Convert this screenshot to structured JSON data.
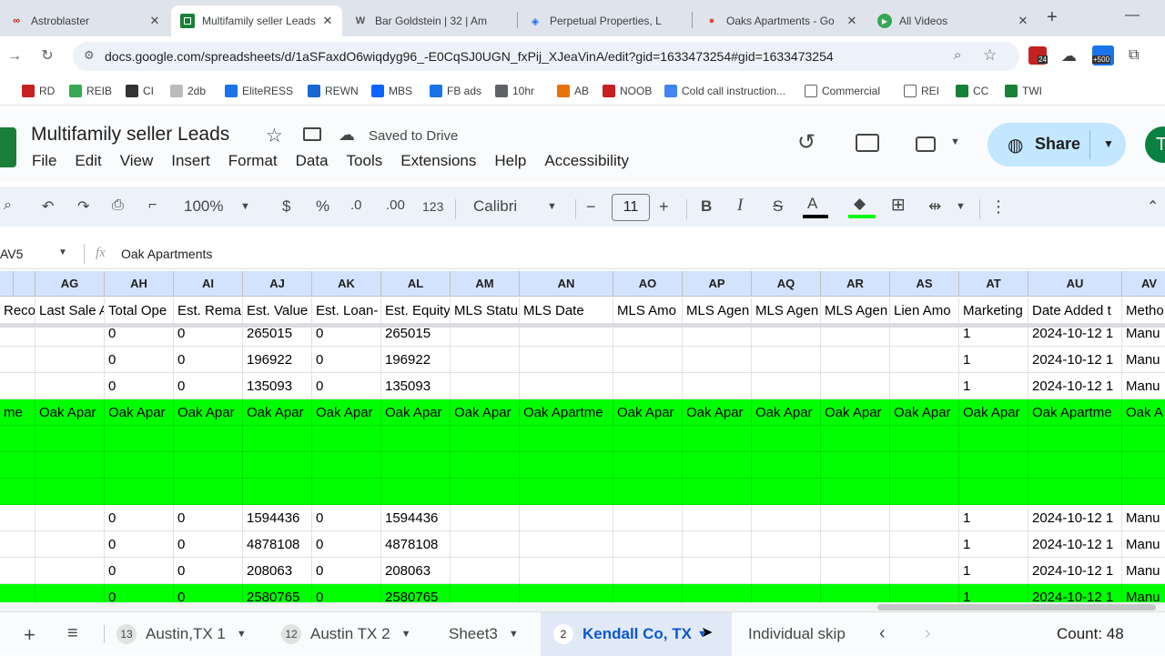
{
  "browser": {
    "tabs": [
      {
        "title": "Astroblaster",
        "active": false
      },
      {
        "title": "Multifamily seller Leads",
        "active": true
      },
      {
        "title": "Bar Goldstein | 32 | Am",
        "active": false
      },
      {
        "title": "Perpetual Properties, L",
        "active": false
      },
      {
        "title": "Oaks Apartments - Go",
        "active": false
      },
      {
        "title": "All Videos",
        "active": false
      }
    ],
    "new_tab": "+",
    "url": "docs.google.com/spreadsheets/d/1aSFaxdO6wiqdyg96_-E0CqSJ0UGN_fxPij_XJeaVinA/edit?gid=1633473254#gid=1633473254",
    "ext_badge_1": "24",
    "ext_badge_2": "+500",
    "bookmarks": [
      "RD",
      "REIB",
      "CI",
      "2db",
      "EliteRESS",
      "REWN",
      "MBS",
      "FB ads",
      "10hr",
      "AB",
      "NOOB",
      "Cold call instruction...",
      "Commercial",
      "REI",
      "CC",
      "TWI"
    ]
  },
  "sheet": {
    "title": "Multifamily seller Leads",
    "saved_status": "Saved to Drive",
    "menu": [
      "File",
      "Edit",
      "View",
      "Insert",
      "Format",
      "Data",
      "Tools",
      "Extensions",
      "Help",
      "Accessibility"
    ],
    "share_label": "Share",
    "avatar_letter": "T",
    "toolbar": {
      "zoom": "100%",
      "currency": "$",
      "percent": "%",
      "dec_decrease": ".0",
      "dec_increase": ".00",
      "number_format": "123",
      "font": "Calibri",
      "font_size": "11",
      "bold": "B",
      "italic": "I",
      "strike": "S",
      "text_color": "A",
      "minus": "−",
      "plus": "+"
    },
    "name_box": "AV5",
    "fx_label": "fx",
    "formula": "Oak Apartments"
  },
  "grid": {
    "columns": [
      "AG",
      "AH",
      "AI",
      "AJ",
      "AK",
      "AL",
      "AM",
      "AN",
      "AO",
      "AP",
      "AQ",
      "AR",
      "AS",
      "AT",
      "AU",
      "AV"
    ],
    "header_row": [
      "Last Sale A",
      "Total Ope",
      "Est. Rema",
      "Est. Value",
      "Est. Loan-",
      "Est. Equity",
      "MLS Statu",
      "MLS Date",
      "MLS Amo",
      "MLS Agen",
      "MLS Agen",
      "MLS Agen",
      "Lien Amo",
      "Marketing",
      "Date Added t",
      "Metho"
    ],
    "left_partial": [
      "Reco",
      "me"
    ],
    "rows": [
      {
        "cells": [
          "",
          "0",
          "0",
          "265015",
          "0",
          "265015",
          "",
          "",
          "",
          "",
          "",
          "",
          "",
          "1",
          "2024-10-12 1",
          "Manu"
        ],
        "green": false
      },
      {
        "cells": [
          "",
          "0",
          "0",
          "196922",
          "0",
          "196922",
          "",
          "",
          "",
          "",
          "",
          "",
          "",
          "1",
          "2024-10-12 1",
          "Manu"
        ],
        "green": false
      },
      {
        "cells": [
          "",
          "0",
          "0",
          "135093",
          "0",
          "135093",
          "",
          "",
          "",
          "",
          "",
          "",
          "",
          "1",
          "2024-10-12 1",
          "Manu"
        ],
        "green": false
      },
      {
        "cells": [
          "Oak Apar",
          "Oak Apar",
          "Oak Apar",
          "Oak Apar",
          "Oak Apar",
          "Oak Apar",
          "Oak Apar",
          "Oak Apartme",
          "Oak Apar",
          "Oak Apar",
          "Oak Apar",
          "Oak Apar",
          "Oak Apar",
          "Oak Apar",
          "Oak Apartme",
          "Oak A"
        ],
        "green": true
      },
      {
        "cells": [
          "",
          "",
          "",
          "",
          "",
          "",
          "",
          "",
          "",
          "",
          "",
          "",
          "",
          "",
          "",
          ""
        ],
        "green": true
      },
      {
        "cells": [
          "",
          "",
          "",
          "",
          "",
          "",
          "",
          "",
          "",
          "",
          "",
          "",
          "",
          "",
          "",
          ""
        ],
        "green": true
      },
      {
        "cells": [
          "",
          "",
          "",
          "",
          "",
          "",
          "",
          "",
          "",
          "",
          "",
          "",
          "",
          "",
          "",
          ""
        ],
        "green": true
      },
      {
        "cells": [
          "",
          "0",
          "0",
          "1594436",
          "0",
          "1594436",
          "",
          "",
          "",
          "",
          "",
          "",
          "",
          "1",
          "2024-10-12 1",
          "Manu"
        ],
        "green": false
      },
      {
        "cells": [
          "",
          "0",
          "0",
          "4878108",
          "0",
          "4878108",
          "",
          "",
          "",
          "",
          "",
          "",
          "",
          "1",
          "2024-10-12 1",
          "Manu"
        ],
        "green": false
      },
      {
        "cells": [
          "",
          "0",
          "0",
          "208063",
          "0",
          "208063",
          "",
          "",
          "",
          "",
          "",
          "",
          "",
          "1",
          "2024-10-12 1",
          "Manu"
        ],
        "green": false
      },
      {
        "cells": [
          "",
          "0",
          "0",
          "2580765",
          "0",
          "2580765",
          "",
          "",
          "",
          "",
          "",
          "",
          "",
          "1",
          "2024-10-12 1",
          "Manu"
        ],
        "green": true
      }
    ]
  },
  "sheet_tabs": [
    {
      "badge": "13",
      "name": "Austin,TX 1",
      "active": false
    },
    {
      "badge": "12",
      "name": "Austin TX 2",
      "active": false
    },
    {
      "badge": "",
      "name": "Sheet3",
      "active": false
    },
    {
      "badge": "2",
      "name": "Kendall Co, TX",
      "active": true
    },
    {
      "badge": "",
      "name": "Individual skip",
      "active": false
    }
  ],
  "status": "Count: 48",
  "colors": {
    "accent": "#0b57d0",
    "highlight_green": "#00ff00",
    "share_bg": "#c2e7ff"
  }
}
